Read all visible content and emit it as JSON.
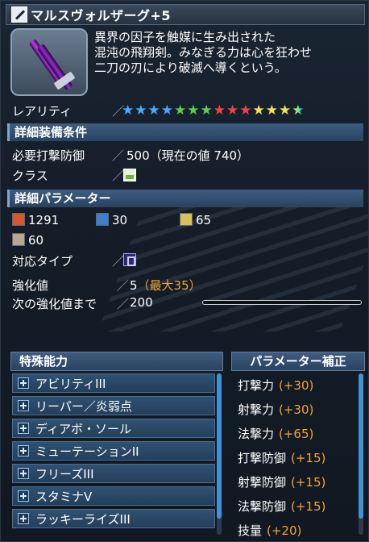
{
  "item": {
    "title": "マルスヴォルザーグ+5",
    "description": [
      "異界の因子を触媒に生み出された",
      "混沌の飛翔剣。みなぎる力は心を狂わせ",
      "二刀の刃により破滅へ導くという。"
    ]
  },
  "rarity": {
    "label": "レアリティ",
    "sep": "／",
    "stars": [
      "#4aa8ff",
      "#4aa8ff",
      "#4aa8ff",
      "#4aa8ff",
      "#5ad04a",
      "#5ad04a",
      "#5ad04a",
      "#ef4444",
      "#ef4444",
      "#ef4444",
      "#f2e05a",
      "#f2e05a",
      "#f2e05a",
      "rainbow"
    ]
  },
  "requirements": {
    "header": "詳細装備条件",
    "req_label": "必要打撃防御",
    "req_value": "500（現在の値 740）",
    "class_label": "クラス",
    "sep": "／"
  },
  "params": {
    "header": "詳細パラメーター",
    "atk": "1291",
    "rng": "30",
    "tec": "65",
    "rdef": "60",
    "type_label": "対応タイプ",
    "grind_label": "強化値",
    "grind_value": "5",
    "grind_max": "（最大35）",
    "next_label": "次の強化値まで",
    "next_value": "200",
    "next_progress": 0.0,
    "sep": "／"
  },
  "abilities": {
    "header": "特殊能力",
    "items": [
      "アビリティIII",
      "リーパー／炎弱点",
      "ディアボ・ソール",
      "ミューテーションII",
      "フリーズIII",
      "スタミナV",
      "ラッキーライズIII"
    ]
  },
  "param_correction": {
    "header": "パラメーター補正",
    "items": [
      {
        "name": "打撃力",
        "value": "(+30)"
      },
      {
        "name": "射撃力",
        "value": "(+30)"
      },
      {
        "name": "法撃力",
        "value": "(+65)"
      },
      {
        "name": "打撃防御",
        "value": "(+15)"
      },
      {
        "name": "射撃防御",
        "value": "(+15)"
      },
      {
        "name": "法撃防御",
        "value": "(+15)"
      },
      {
        "name": "技量",
        "value": "(+20)"
      }
    ]
  }
}
